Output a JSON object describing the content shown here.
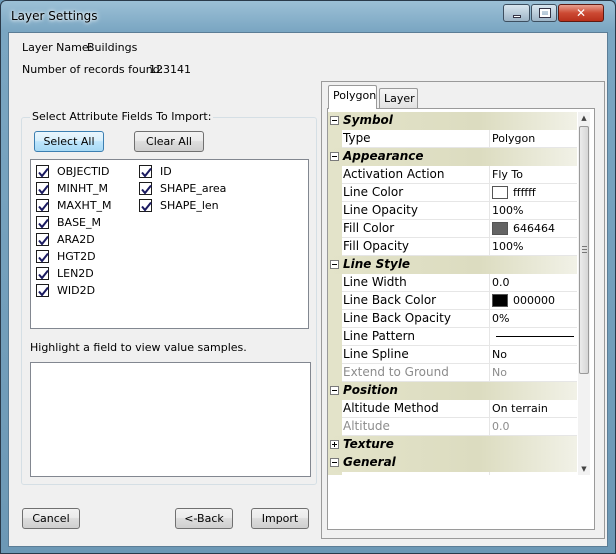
{
  "window": {
    "title": "Layer Settings",
    "controls": {
      "minimize": "minimize-icon",
      "maximize": "maximize-icon",
      "close": "close-icon"
    }
  },
  "info": {
    "layer_name_label": "Layer Name:",
    "layer_name_value": "Buildings",
    "records_label": "Number of records found:",
    "records_value": "123141"
  },
  "fields_section": {
    "title": "Select Attribute Fields To Import:",
    "select_all": "Select All",
    "clear_all": "Clear All",
    "col1": [
      {
        "name": "OBJECTID",
        "checked": true
      },
      {
        "name": "MINHT_M",
        "checked": true
      },
      {
        "name": "MAXHT_M",
        "checked": true
      },
      {
        "name": "BASE_M",
        "checked": true
      },
      {
        "name": "ARA2D",
        "checked": true
      },
      {
        "name": "HGT2D",
        "checked": true
      },
      {
        "name": "LEN2D",
        "checked": true
      },
      {
        "name": "WID2D",
        "checked": true
      }
    ],
    "col2": [
      {
        "name": "ID",
        "checked": true
      },
      {
        "name": "SHAPE_area",
        "checked": true
      },
      {
        "name": "SHAPE_len",
        "checked": true
      }
    ],
    "hint": "Highlight a field to view value samples."
  },
  "tabs": [
    "Polygon",
    "Layer"
  ],
  "active_tab": "Polygon",
  "properties": [
    {
      "kind": "cat",
      "name": "Symbol",
      "expanded": true
    },
    {
      "kind": "prop",
      "name": "Type",
      "value": "Polygon"
    },
    {
      "kind": "cat",
      "name": "Appearance",
      "expanded": true
    },
    {
      "kind": "prop",
      "name": "Activation Action",
      "value": "Fly To"
    },
    {
      "kind": "prop",
      "name": "Line Color",
      "value": "ffffff",
      "swatch": "#ffffff"
    },
    {
      "kind": "prop",
      "name": "Line Opacity",
      "value": "100%"
    },
    {
      "kind": "prop",
      "name": "Fill Color",
      "value": "646464",
      "swatch": "#646464"
    },
    {
      "kind": "prop",
      "name": "Fill Opacity",
      "value": "100%"
    },
    {
      "kind": "cat",
      "name": "Line Style",
      "expanded": true
    },
    {
      "kind": "prop",
      "name": "Line Width",
      "value": "0.0"
    },
    {
      "kind": "prop",
      "name": "Line Back Color",
      "value": "000000",
      "swatch": "#000000"
    },
    {
      "kind": "prop",
      "name": "Line Back Opacity",
      "value": "0%"
    },
    {
      "kind": "prop",
      "name": "Line Pattern",
      "value": "",
      "pattern": "solid"
    },
    {
      "kind": "prop",
      "name": "Line Spline",
      "value": "No"
    },
    {
      "kind": "prop",
      "name": "Extend to Ground",
      "value": "No",
      "disabled": true
    },
    {
      "kind": "cat",
      "name": "Position",
      "expanded": true
    },
    {
      "kind": "prop",
      "name": "Altitude Method",
      "value": "On terrain"
    },
    {
      "kind": "prop",
      "name": "Altitude",
      "value": "0.0",
      "disabled": true
    },
    {
      "kind": "cat",
      "name": "Texture",
      "expanded": false
    },
    {
      "kind": "cat",
      "name": "General",
      "expanded": true
    },
    {
      "kind": "prop",
      "name": "",
      "value": ""
    }
  ],
  "buttons": {
    "cancel": "Cancel",
    "back": "<-Back",
    "import": "Import"
  },
  "colors": {
    "category_bg": "#e3e3c9",
    "title_bar": "#7aa6c2",
    "close_button": "#cc4a33"
  }
}
